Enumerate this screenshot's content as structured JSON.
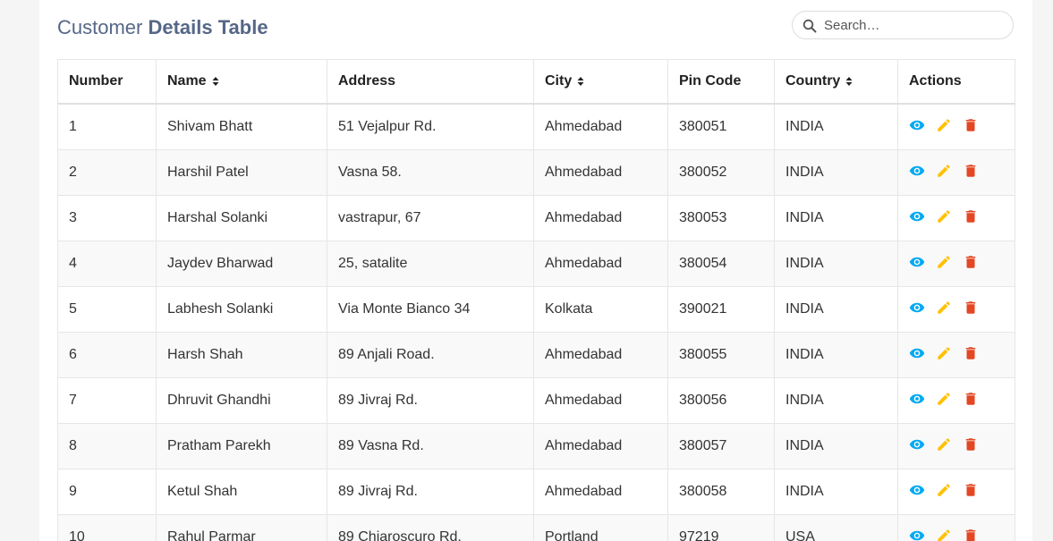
{
  "header": {
    "title_light": "Customer",
    "title_bold": "Details Table",
    "search_placeholder": "Search…",
    "search_icon": "search-icon"
  },
  "table": {
    "columns": [
      {
        "label": "Number",
        "sortable": false
      },
      {
        "label": "Name",
        "sortable": true
      },
      {
        "label": "Address",
        "sortable": false
      },
      {
        "label": "City",
        "sortable": true
      },
      {
        "label": "Pin Code",
        "sortable": false
      },
      {
        "label": "Country",
        "sortable": true
      },
      {
        "label": "Actions",
        "sortable": false
      }
    ],
    "rows": [
      {
        "number": "1",
        "name": "Shivam Bhatt",
        "address": "51 Vejalpur Rd.",
        "city": "Ahmedabad",
        "pin": "380051",
        "country": "INDIA"
      },
      {
        "number": "2",
        "name": "Harshil Patel",
        "address": "Vasna 58.",
        "city": "Ahmedabad",
        "pin": "380052",
        "country": "INDIA"
      },
      {
        "number": "3",
        "name": "Harshal Solanki",
        "address": "vastrapur, 67",
        "city": "Ahmedabad",
        "pin": "380053",
        "country": "INDIA"
      },
      {
        "number": "4",
        "name": "Jaydev Bharwad",
        "address": "25, satalite",
        "city": "Ahmedabad",
        "pin": "380054",
        "country": "INDIA"
      },
      {
        "number": "5",
        "name": "Labhesh Solanki",
        "address": "Via Monte Bianco 34",
        "city": "Kolkata",
        "pin": "390021",
        "country": "INDIA"
      },
      {
        "number": "6",
        "name": "Harsh Shah",
        "address": "89 Anjali Road.",
        "city": "Ahmedabad",
        "pin": "380055",
        "country": "INDIA"
      },
      {
        "number": "7",
        "name": "Dhruvit Ghandhi",
        "address": "89 Jivraj Rd.",
        "city": "Ahmedabad",
        "pin": "380056",
        "country": "INDIA"
      },
      {
        "number": "8",
        "name": "Pratham Parekh",
        "address": "89 Vasna Rd.",
        "city": "Ahmedabad",
        "pin": "380057",
        "country": "INDIA"
      },
      {
        "number": "9",
        "name": "Ketul Shah",
        "address": "89 Jivraj Rd.",
        "city": "Ahmedabad",
        "pin": "380058",
        "country": "INDIA"
      },
      {
        "number": "10",
        "name": "Rahul Parmar",
        "address": "89 Chiaroscuro Rd.",
        "city": "Portland",
        "pin": "97219",
        "country": "USA"
      }
    ],
    "actions": [
      {
        "icon": "eye-icon",
        "color": "#03a9f4"
      },
      {
        "icon": "pencil-icon",
        "color": "#ffc107"
      },
      {
        "icon": "trash-icon",
        "color": "#e34724"
      }
    ]
  }
}
